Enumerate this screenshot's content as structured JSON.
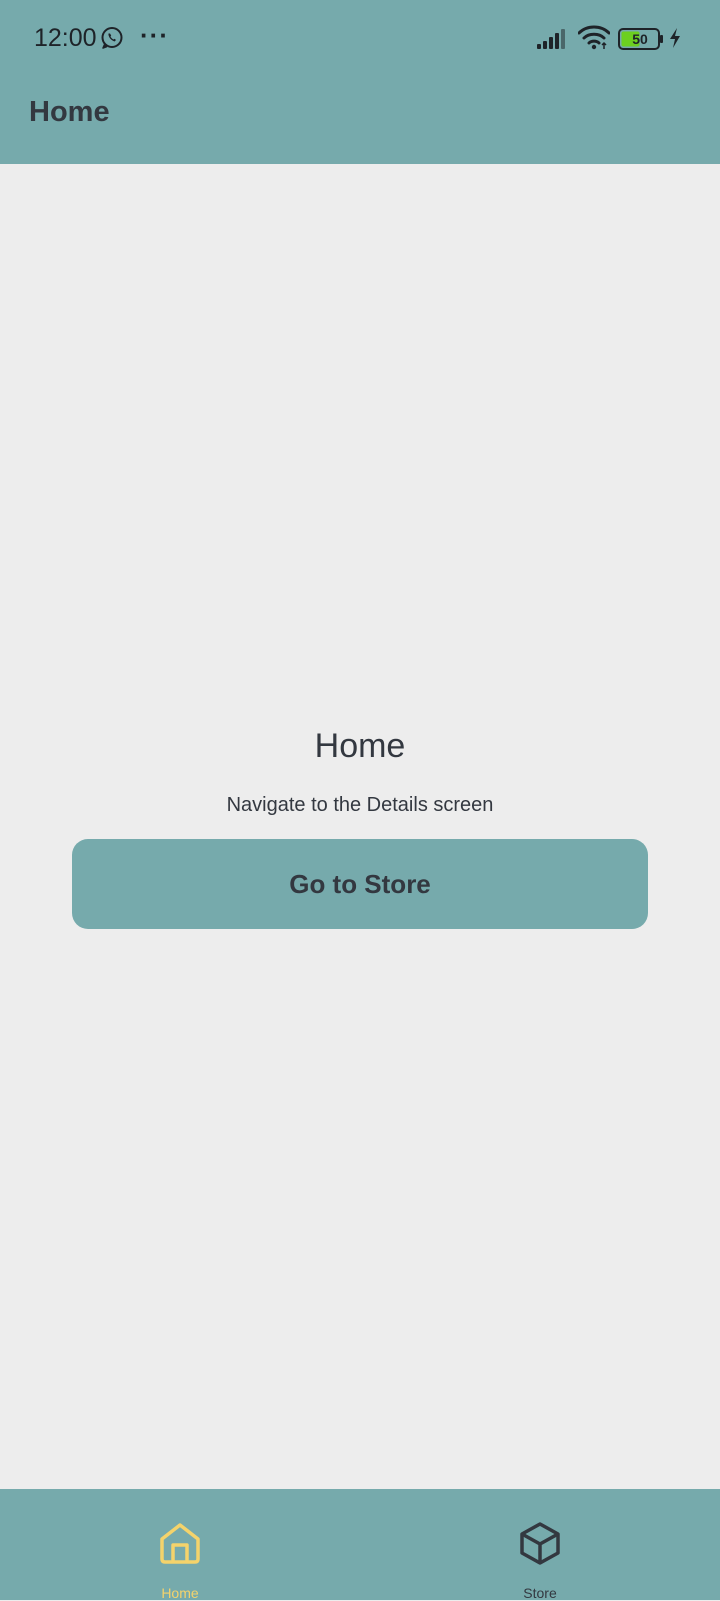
{
  "status_bar": {
    "time": "12:00",
    "overflow_indicator": "···",
    "battery_level": "50",
    "icons": [
      "whatsapp-icon",
      "signal-icon",
      "wifi-icon",
      "battery-icon",
      "charging-icon"
    ]
  },
  "app_bar": {
    "title": "Home"
  },
  "main": {
    "heading": "Home",
    "subtitle": "Navigate to the Details screen",
    "button_label": "Go to Store"
  },
  "bottom_nav": {
    "tabs": [
      {
        "label": "Home",
        "icon": "home-icon",
        "active": true
      },
      {
        "label": "Store",
        "icon": "cube-icon",
        "active": false
      }
    ]
  },
  "colors": {
    "accent": "#76AAAC",
    "background": "#EDEDED",
    "text": "#333840",
    "active_tab": "#F4D36B",
    "battery_fill": "#6CD020"
  }
}
